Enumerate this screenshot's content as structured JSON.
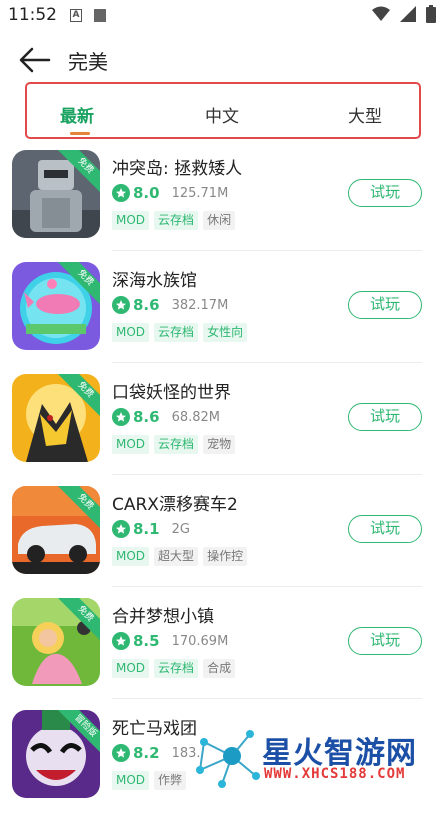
{
  "status": {
    "time": "11:52",
    "icon_a": "A"
  },
  "header": {
    "title": "完美"
  },
  "tabs": [
    "最新",
    "中文",
    "大型"
  ],
  "badge_free": "免费",
  "badge_adventure": "冒险版",
  "try_label": "试玩",
  "apps": [
    {
      "name": "冲突岛: 拯救矮人",
      "rating": "8.0",
      "size": "125.71M",
      "tags": [
        "MOD",
        "云存档",
        "休闲"
      ]
    },
    {
      "name": "深海水族馆",
      "rating": "8.6",
      "size": "382.17M",
      "tags": [
        "MOD",
        "云存档",
        "女性向"
      ]
    },
    {
      "name": "口袋妖怪的世界",
      "rating": "8.6",
      "size": "68.82M",
      "tags": [
        "MOD",
        "云存档",
        "宠物"
      ]
    },
    {
      "name": "CARX漂移赛车2",
      "rating": "8.1",
      "size": "2G",
      "tags": [
        "MOD",
        "超大型",
        "操作控"
      ]
    },
    {
      "name": "合并梦想小镇",
      "rating": "8.5",
      "size": "170.69M",
      "tags": [
        "MOD",
        "云存档",
        "合成"
      ]
    },
    {
      "name": "死亡马戏团",
      "rating": "8.2",
      "size": "183.",
      "tags": [
        "MOD",
        "作弊"
      ]
    }
  ],
  "watermark": {
    "title": "星火智游网",
    "url": "WWW.XHCS188.COM"
  },
  "colors": {
    "accent": "#2eb872",
    "tab_active": "#1aa260",
    "tab_border": "#e24a4a",
    "underline": "#e6833a"
  }
}
